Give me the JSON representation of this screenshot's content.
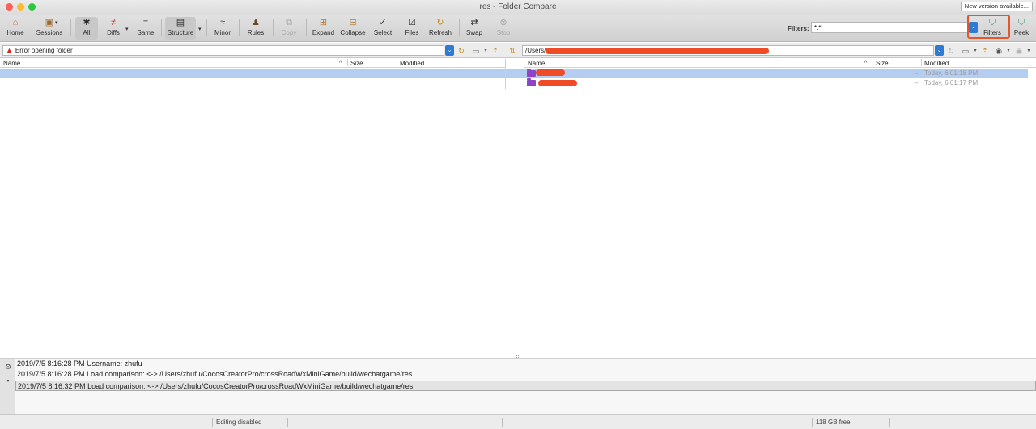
{
  "window": {
    "title": "res - Folder Compare",
    "new_version_label": "New version available..."
  },
  "toolbar": {
    "buttons": [
      {
        "label": "Home",
        "icon": "home-icon",
        "glyph": "⌂",
        "state": "normal"
      },
      {
        "label": "Sessions",
        "icon": "briefcase-icon",
        "glyph": "▣",
        "state": "normal"
      },
      {
        "label": "All",
        "icon": "asterisk-icon",
        "glyph": "✱",
        "state": "active"
      },
      {
        "label": "Diffs",
        "icon": "not-equal-icon",
        "glyph": "≠",
        "state": "normal"
      },
      {
        "label": "Same",
        "icon": "equals-icon",
        "glyph": "=",
        "state": "normal"
      },
      {
        "label": "Structure",
        "icon": "structure-icon",
        "glyph": "▤",
        "state": "active"
      },
      {
        "label": "Minor",
        "icon": "approx-icon",
        "glyph": "≈",
        "state": "normal"
      },
      {
        "label": "Rules",
        "icon": "referee-icon",
        "glyph": "♟",
        "state": "normal"
      },
      {
        "label": "Copy",
        "icon": "copy-icon",
        "glyph": "⧉",
        "state": "disabled"
      },
      {
        "label": "Expand",
        "icon": "expand-icon",
        "glyph": "⊞",
        "state": "normal"
      },
      {
        "label": "Collapse",
        "icon": "collapse-icon",
        "glyph": "⊟",
        "state": "normal"
      },
      {
        "label": "Select",
        "icon": "select-icon",
        "glyph": "✓",
        "state": "normal"
      },
      {
        "label": "Files",
        "icon": "files-icon",
        "glyph": "☑",
        "state": "normal"
      },
      {
        "label": "Refresh",
        "icon": "refresh-icon",
        "glyph": "↻",
        "state": "normal"
      },
      {
        "label": "Swap",
        "icon": "swap-icon",
        "glyph": "⇄",
        "state": "normal"
      },
      {
        "label": "Stop",
        "icon": "stop-icon",
        "glyph": "⊗",
        "state": "disabled"
      }
    ],
    "filters_label": "Filters:",
    "filters_value": "*.*",
    "filters_button": "Filters",
    "peek_button": "Peek"
  },
  "left_pane": {
    "path_text": "Error opening folder",
    "columns": {
      "name": "Name",
      "size": "Size",
      "modified": "Modified"
    }
  },
  "right_pane": {
    "path_prefix": "/Users/",
    "columns": {
      "name": "Name",
      "size": "Size",
      "modified": "Modified"
    },
    "rows": [
      {
        "size": "--",
        "modified": "Today, 6:01:18 PM"
      },
      {
        "size": "--",
        "modified": "Today, 6:01:17 PM"
      }
    ]
  },
  "log": {
    "lines": [
      "2019/7/5 8:16:28 PM  Username: zhufu",
      "2019/7/5 8:16:28 PM  Load comparison:  <-> /Users/zhufu/CocosCreatorPro/crossRoadWxMiniGame/build/wechatgame/res",
      "2019/7/5 8:16:32 PM  Load comparison:  <-> /Users/zhufu/CocosCreatorPro/crossRoadWxMiniGame/build/wechatgame/res"
    ]
  },
  "statusbar": {
    "editing": "Editing disabled",
    "free_space": "118 GB free"
  },
  "colors": {
    "selection": "#b4cdf0",
    "accent": "#2e7bd6",
    "folder": "#8e44c7",
    "redaction": "#ef4b26",
    "highlight": "#e4572e"
  }
}
